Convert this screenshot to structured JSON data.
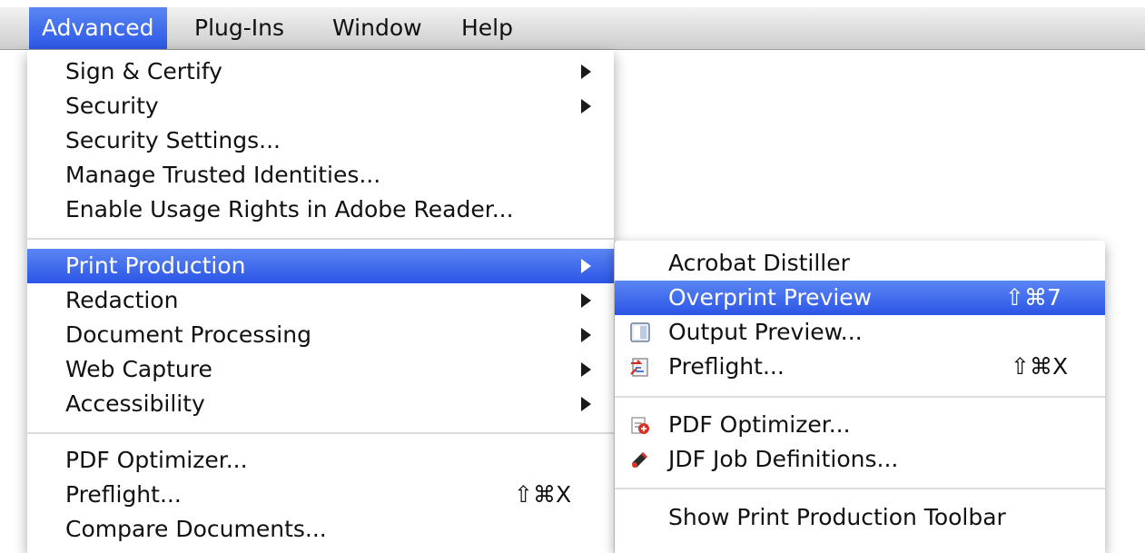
{
  "menubar": {
    "items": [
      {
        "label": "Advanced"
      },
      {
        "label": "Plug-Ins"
      },
      {
        "label": "Window"
      },
      {
        "label": "Help"
      }
    ]
  },
  "advanced_menu": {
    "items": [
      {
        "label": "Sign & Certify"
      },
      {
        "label": "Security"
      },
      {
        "label": "Security Settings..."
      },
      {
        "label": "Manage Trusted Identities..."
      },
      {
        "label": "Enable Usage Rights in Adobe Reader..."
      },
      {
        "label": "Print Production"
      },
      {
        "label": "Redaction"
      },
      {
        "label": "Document Processing"
      },
      {
        "label": "Web Capture"
      },
      {
        "label": "Accessibility"
      },
      {
        "label": "PDF Optimizer..."
      },
      {
        "label": "Preflight...",
        "shortcut": "⇧⌘X"
      },
      {
        "label": "Compare Documents..."
      }
    ]
  },
  "print_production_menu": {
    "items": [
      {
        "label": "Acrobat Distiller"
      },
      {
        "label": "Overprint Preview",
        "shortcut": "⇧⌘7"
      },
      {
        "label": "Output Preview...",
        "icon": "output-preview-icon"
      },
      {
        "label": "Preflight...",
        "shortcut": "⇧⌘X",
        "icon": "preflight-icon"
      },
      {
        "label": "PDF Optimizer...",
        "icon": "pdf-optimizer-icon"
      },
      {
        "label": "JDF Job Definitions...",
        "icon": "jdf-icon"
      },
      {
        "label": "Show Print Production Toolbar"
      }
    ]
  },
  "colors": {
    "highlight": "#3d6cec",
    "menubar": "#dcdcdc"
  }
}
